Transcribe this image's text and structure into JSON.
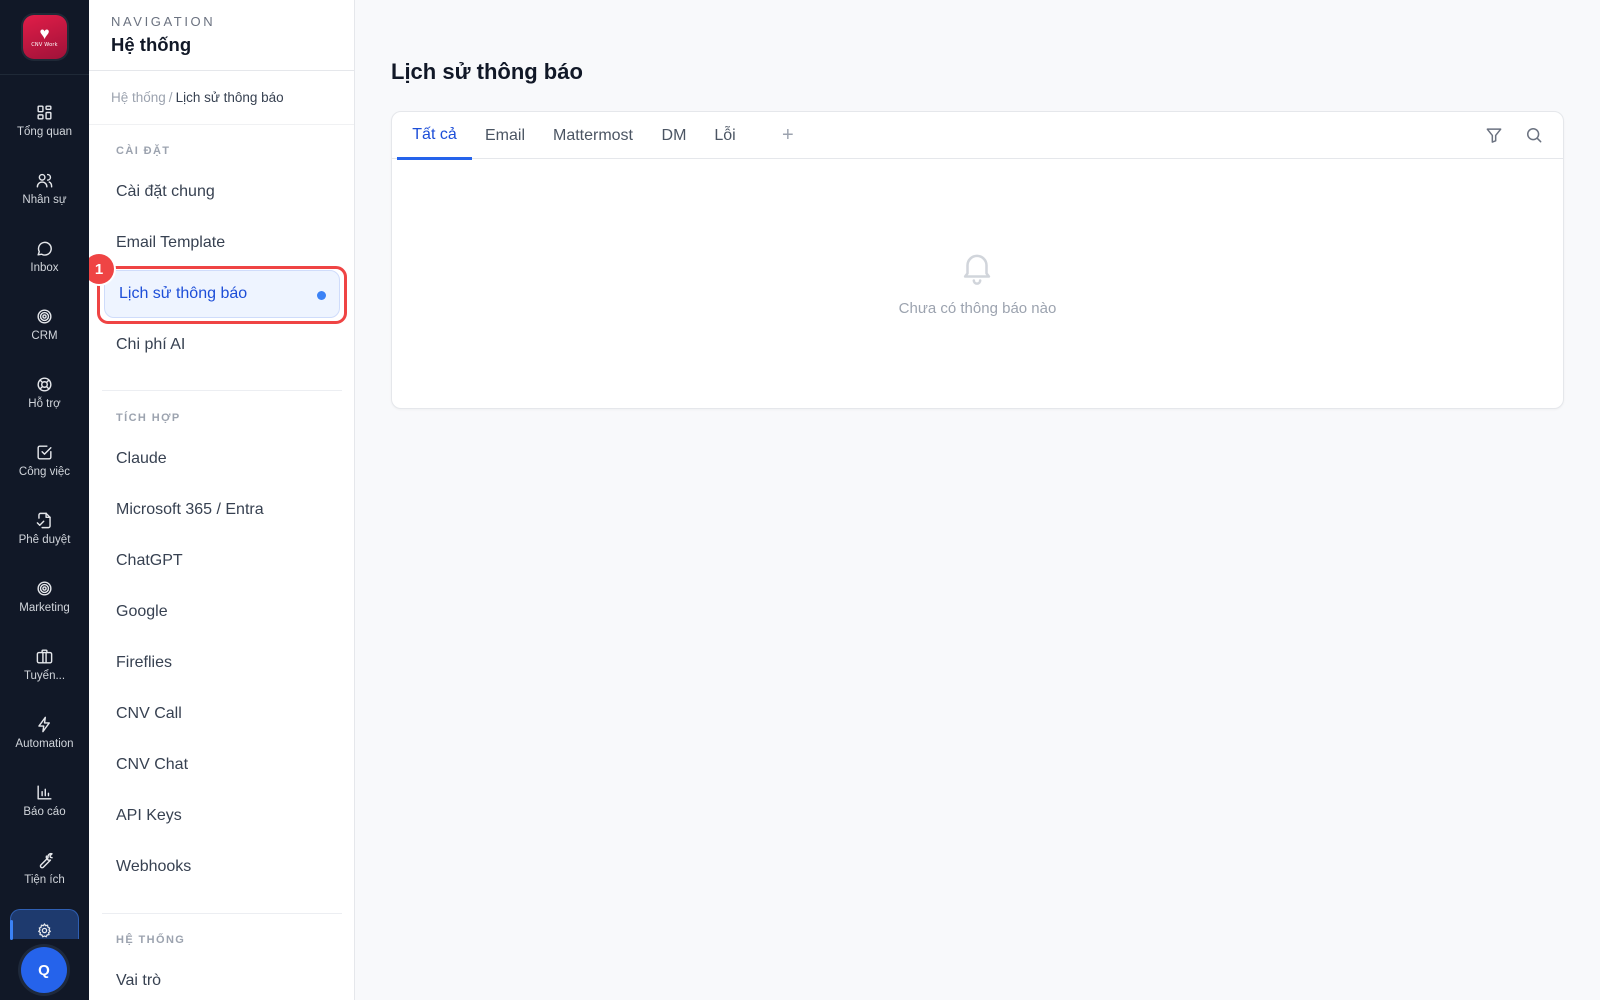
{
  "app": {
    "logo_text": "CNV Work",
    "avatar_initial": "Q"
  },
  "rail": {
    "items": [
      {
        "label": "Tổng quan",
        "icon": "grid-icon"
      },
      {
        "label": "Nhân sự",
        "icon": "users-icon"
      },
      {
        "label": "Inbox",
        "icon": "chat-bubble-icon"
      },
      {
        "label": "CRM",
        "icon": "target-icon"
      },
      {
        "label": "Hỗ trợ",
        "icon": "lifebuoy-icon"
      },
      {
        "label": "Công việc",
        "icon": "checkbox-icon"
      },
      {
        "label": "Phê duyệt",
        "icon": "document-approve-icon"
      },
      {
        "label": "Marketing",
        "icon": "target-icon"
      },
      {
        "label": "Tuyển...",
        "icon": "briefcase-icon"
      },
      {
        "label": "Automation",
        "icon": "lightning-icon"
      },
      {
        "label": "Báo cáo",
        "icon": "bar-chart-icon"
      },
      {
        "label": "Tiện ích",
        "icon": "wrench-icon"
      }
    ],
    "active_icon": "gear-icon"
  },
  "subnav": {
    "kicker": "NAVIGATION",
    "title": "Hệ thống",
    "breadcrumb": {
      "root": "Hệ thống",
      "separator": "/",
      "current": "Lịch sử thông báo"
    },
    "sections": [
      {
        "label": "CÀI ĐẶT",
        "items": [
          "Cài đặt chung",
          "Email Template",
          "Lịch sử thông báo",
          "Chi phí AI"
        ]
      },
      {
        "label": "TÍCH HỢP",
        "items": [
          "Claude",
          "Microsoft 365 / Entra",
          "ChatGPT",
          "Google",
          "Fireflies",
          "CNV Call",
          "CNV Chat",
          "API Keys",
          "Webhooks"
        ]
      },
      {
        "label": "HỆ THỐNG",
        "items": [
          "Vai trò"
        ]
      }
    ],
    "active_item": "Lịch sử thông báo",
    "marker_number": "1"
  },
  "main": {
    "title": "Lịch sử thông báo",
    "tabs": [
      "Tất cả",
      "Email",
      "Mattermost",
      "DM",
      "Lỗi"
    ],
    "active_tab": "Tất cả",
    "add_tab_symbol": "+",
    "empty_state": "Chưa có thông báo nào"
  },
  "colors": {
    "rail_bg": "#111827",
    "accent": "#2563eb",
    "highlight": "#ef4444",
    "logo": "#e11d48"
  }
}
